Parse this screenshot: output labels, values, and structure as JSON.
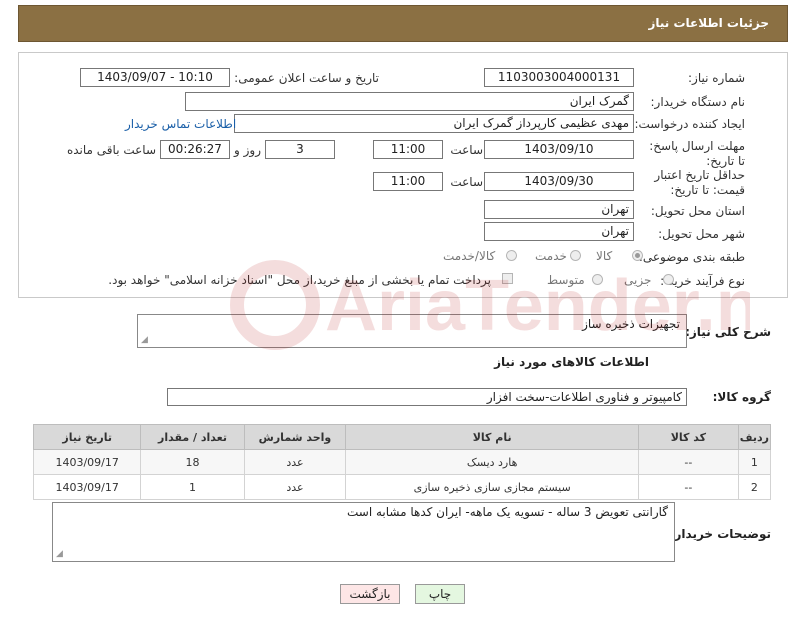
{
  "header": {
    "title": "جزئیات اطلاعات نیاز"
  },
  "form": {
    "need_number_label": "شماره نیاز:",
    "need_number": "1103003004000131",
    "announce_label": "تاریخ و ساعت اعلان عمومی:",
    "announce_value": "1403/09/07 - 10:10",
    "buyer_org_label": "نام دستگاه خریدار:",
    "buyer_org": "گمرک ایران",
    "creator_label": "ایجاد کننده درخواست:",
    "creator": "مهدی عظیمی کارپرداز گمرک ایران",
    "contact_link": "اطلاعات تماس خریدار",
    "reply_deadline_label": "مهلت ارسال پاسخ: تا تاریخ:",
    "reply_date": "1403/09/10",
    "time_label": "ساعت",
    "reply_time": "11:00",
    "days_value": "3",
    "days_label": "روز و",
    "remaining_value": "00:26:27",
    "remaining_label": "ساعت باقی مانده",
    "validity_label": "حداقل تاریخ اعتبار قیمت: تا تاریخ:",
    "validity_date": "1403/09/30",
    "validity_time": "11:00",
    "province_label": "استان محل تحویل:",
    "province": "تهران",
    "city_label": "شهر محل تحویل:",
    "city": "تهران",
    "category_label": "طبقه بندی موضوعی:",
    "category_options": [
      "کالا",
      "خدمت",
      "کالا/خدمت"
    ],
    "process_label": "نوع فرآیند خرید :",
    "process_options": [
      "جزیی",
      "متوسط"
    ],
    "payment_note": "پرداخت تمام یا بخشی از مبلغ خرید،از محل \"اسناد خزانه اسلامی\" خواهد بود."
  },
  "summary": {
    "label": "شرح کلی نیاز:",
    "value": "تجهیزات ذخیره ساز"
  },
  "goods_section": {
    "title": "اطلاعات کالاهای مورد نیاز",
    "group_label": "گروه کالا:",
    "group_value": "کامپیوتر و فناوری اطلاعات-سخت افزار"
  },
  "table": {
    "headers": [
      "ردیف",
      "کد کالا",
      "نام کالا",
      "واحد شمارش",
      "تعداد / مقدار",
      "تاریخ نیاز"
    ],
    "rows": [
      [
        "1",
        "--",
        "هارد دیسک",
        "عدد",
        "18",
        "1403/09/17"
      ],
      [
        "2",
        "--",
        "سیستم مجازی سازی ذخیره سازی",
        "عدد",
        "1",
        "1403/09/17"
      ]
    ]
  },
  "buyer_notes": {
    "label": "توضیحات خریدار:",
    "value": "گارانتی تعویض 3 ساله - تسویه یک ماهه- ایران کدها مشابه است"
  },
  "buttons": {
    "print": "چاپ",
    "back": "بازگشت"
  },
  "watermark": {
    "text": "AriaTender.neT"
  }
}
